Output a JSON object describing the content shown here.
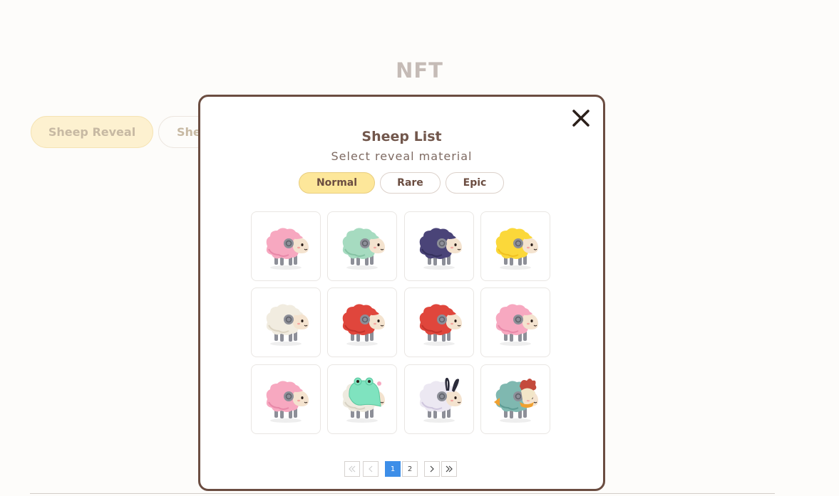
{
  "page": {
    "title": "NFT",
    "tabs": [
      {
        "label": "Sheep Reveal",
        "active": true
      },
      {
        "label": "She",
        "active": false
      }
    ]
  },
  "modal": {
    "title": "Sheep List",
    "subtitle": "Select reveal material",
    "close_icon": "close-icon",
    "rarity_tabs": [
      {
        "label": "Normal",
        "selected": true
      },
      {
        "label": "Rare",
        "selected": false
      },
      {
        "label": "Epic",
        "selected": false
      }
    ],
    "sheep": [
      {
        "color": "pink",
        "wool": "#f7a8c0",
        "shade": "#e888a8"
      },
      {
        "color": "mint",
        "wool": "#a6dbc0",
        "shade": "#86c3a4"
      },
      {
        "color": "navy",
        "wool": "#4a4478",
        "shade": "#34305c"
      },
      {
        "color": "yellow",
        "wool": "#fbd83a",
        "shade": "#f0c020"
      },
      {
        "color": "cream",
        "wool": "#f1ece0",
        "shade": "#ddd5c3"
      },
      {
        "color": "red",
        "wool": "#e0463c",
        "shade": "#c4342c"
      },
      {
        "color": "red",
        "wool": "#e0463c",
        "shade": "#c4342c"
      },
      {
        "color": "pink",
        "wool": "#f7a8c0",
        "shade": "#e888a8"
      },
      {
        "color": "pink",
        "wool": "#f7a8c0",
        "shade": "#e888a8"
      },
      {
        "color": "frog-hood",
        "wool": "#eeeadf",
        "shade": "#d8d2c4",
        "accessory": "frog-hood"
      },
      {
        "color": "bunny-ears",
        "wool": "#ece8f2",
        "shade": "#cfc6de",
        "accessory": "bunny-ears"
      },
      {
        "color": "rooster-costume",
        "wool": "#7fb8b0",
        "shade": "#5e9c94",
        "accessory": "rooster"
      }
    ],
    "pagination": {
      "first_icon": "double-chevron-left-icon",
      "prev_icon": "chevron-left-icon",
      "pages": [
        "1",
        "2"
      ],
      "current_page": "1",
      "next_icon": "chevron-right-icon",
      "last_icon": "double-chevron-right-icon"
    }
  }
}
